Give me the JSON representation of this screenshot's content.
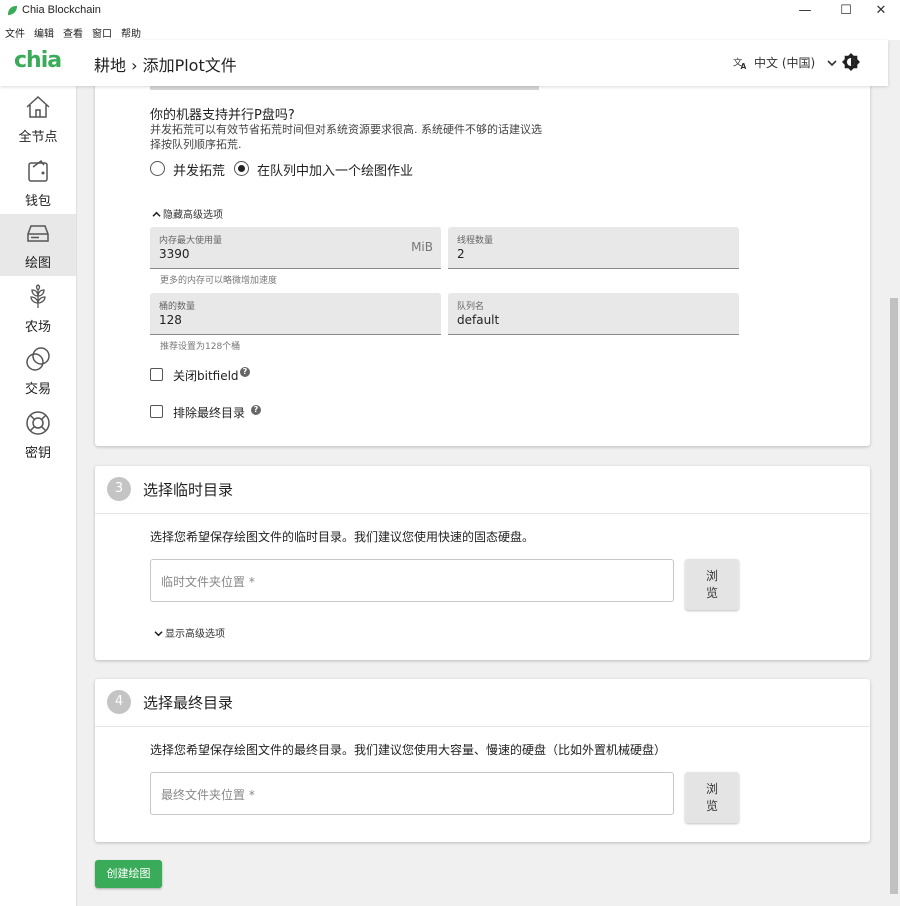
{
  "window": {
    "title": "Chia Blockchain",
    "minimize": "—",
    "maximize": "☐",
    "close": "✕"
  },
  "menu": [
    "文件",
    "编辑",
    "查看",
    "窗口",
    "帮助"
  ],
  "header": {
    "logo": "chia",
    "breadcrumb": "耕地 › 添加Plot文件",
    "language": "中文 (中国)",
    "language_icon": "translate-icon"
  },
  "sidebar": {
    "items": [
      {
        "label": "全节点",
        "icon": "home-icon"
      },
      {
        "label": "钱包",
        "icon": "wallet-icon"
      },
      {
        "label": "绘图",
        "icon": "hdd-icon",
        "active": true
      },
      {
        "label": "农场",
        "icon": "sprout-icon"
      },
      {
        "label": "交易",
        "icon": "trade-icon"
      },
      {
        "label": "密钥",
        "icon": "lifebuoy-icon"
      }
    ]
  },
  "parallel": {
    "question": "你的机器支持并行P盘吗?",
    "description_line1": "并发拓荒可以有效节省拓荒时间但对系统资源要求很高. 系统硬件不够的话建议选",
    "description_line2": "择按队列顺序拓荒.",
    "option_parallel": "并发拓荒",
    "option_queue": "在队列中加入一个绘图作业",
    "selected": "queue"
  },
  "advanced": {
    "toggle_label": "隐藏高级选项",
    "memory": {
      "label": "内存最大使用量",
      "value": "3390",
      "unit": "MiB",
      "helper": "更多的内存可以略微增加速度"
    },
    "threads": {
      "label": "线程数量",
      "value": "2"
    },
    "buckets": {
      "label": "桶的数量",
      "value": "128",
      "helper": "推荐设置为128个桶"
    },
    "queue": {
      "label": "队列名",
      "value": "default"
    },
    "disable_bitfield": {
      "label": "关闭bitfield",
      "checked": false
    },
    "exclude_final_dir": {
      "label": "排除最终目录",
      "checked": false
    },
    "help_glyph": "?"
  },
  "step3": {
    "number": "3",
    "title": "选择临时目录",
    "description": "选择您希望保存绘图文件的临时目录。我们建议您使用快速的固态硬盘。",
    "placeholder": "临时文件夹位置 *",
    "browse": "浏览",
    "toggle_label": "显示高级选项"
  },
  "step4": {
    "number": "4",
    "title": "选择最终目录",
    "description": "选择您希望保存绘图文件的最终目录。我们建议您使用大容量、慢速的硬盘（比如外置机械硬盘）",
    "placeholder": "最终文件夹位置 *",
    "browse": "浏览"
  },
  "create_button": "创建绘图",
  "colors": {
    "brand": "#3aac59",
    "field_bg": "#e8e8e8",
    "step_badge": "#c4c4c4"
  }
}
